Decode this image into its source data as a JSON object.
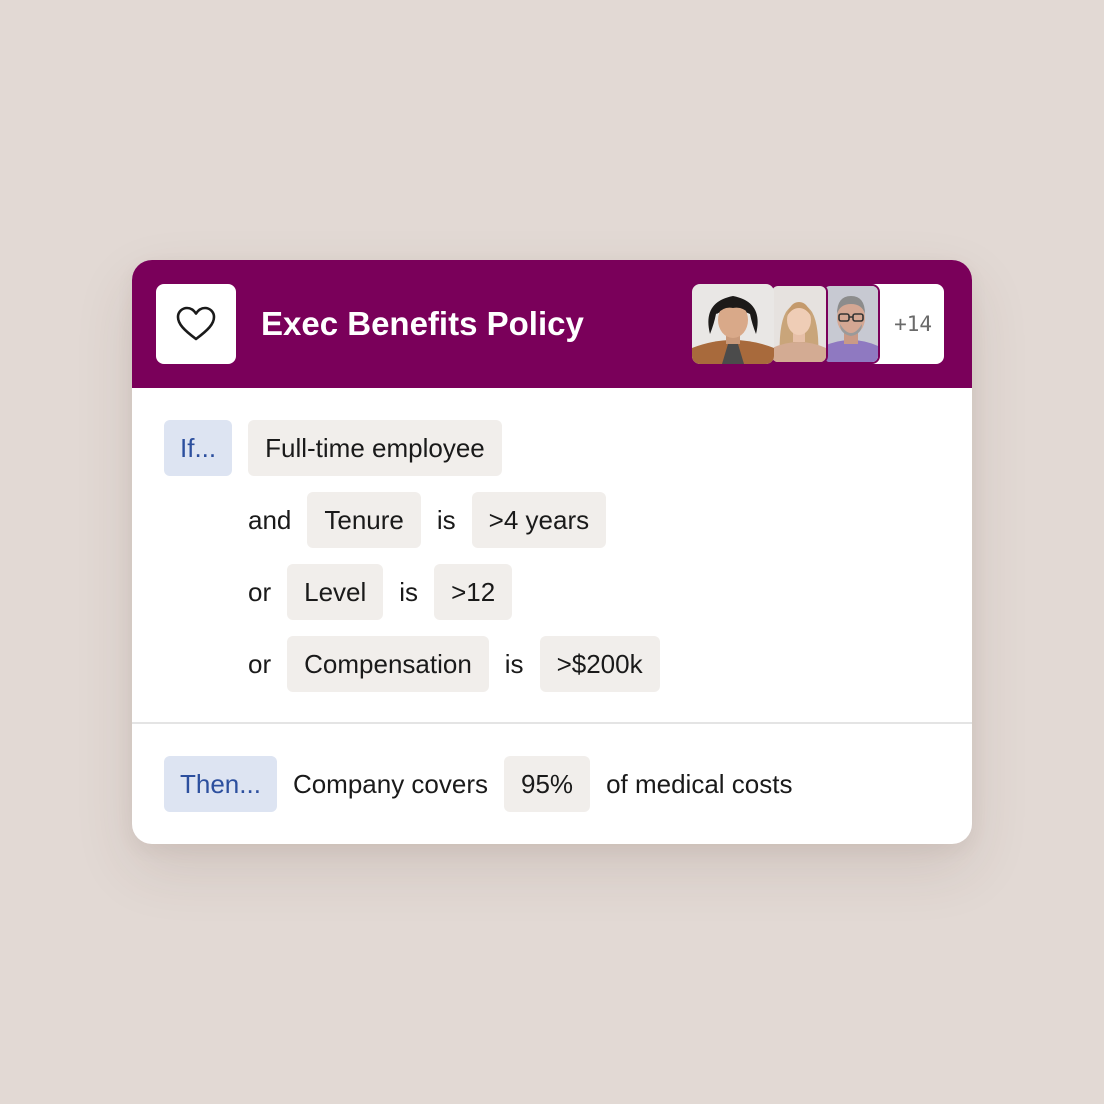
{
  "policy": {
    "title": "Exec Benefits Policy",
    "icon": "heart-icon",
    "members_overflow": "+14",
    "header_color": "#7a005a"
  },
  "conditions": {
    "if_label": "If...",
    "first": "Full-time employee",
    "rows": [
      {
        "connector": "and",
        "field": "Tenure",
        "operator": "is",
        "value": ">4 years"
      },
      {
        "connector": "or",
        "field": "Level",
        "operator": "is",
        "value": ">12"
      },
      {
        "connector": "or",
        "field": "Compensation",
        "operator": "is",
        "value": ">$200k"
      }
    ]
  },
  "outcome": {
    "then_label": "Then...",
    "subject": "Company covers",
    "value": "95%",
    "object": "of medical costs"
  }
}
